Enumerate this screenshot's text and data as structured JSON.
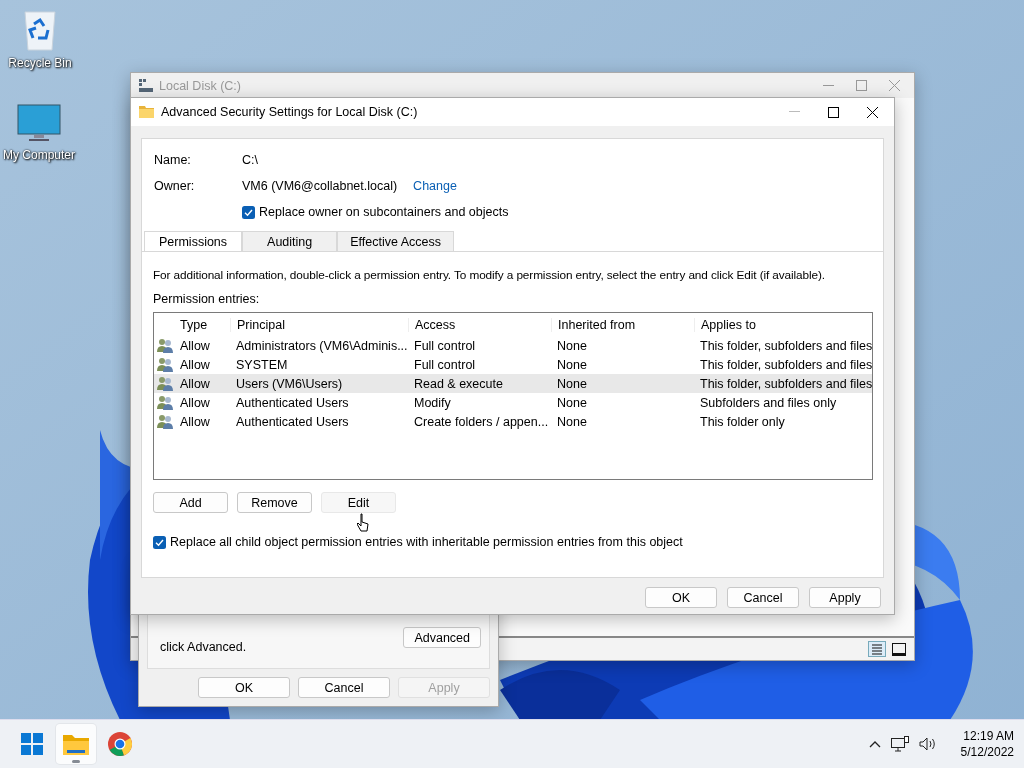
{
  "desktop_icons": [
    {
      "kind": "recycle",
      "label": "Recycle Bin"
    },
    {
      "kind": "computer",
      "label": "My Computer"
    }
  ],
  "back_window": {
    "title": "Local Disk (C:)"
  },
  "properties_dialog": {
    "text": "click Advanced.",
    "advanced_button": "Advanced",
    "buttons": [
      {
        "label": "OK",
        "disabled": false
      },
      {
        "label": "Cancel",
        "disabled": false
      },
      {
        "label": "Apply",
        "disabled": true
      }
    ]
  },
  "dialog": {
    "title": "Advanced Security Settings for Local Disk (C:)",
    "name_label": "Name:",
    "name_value": "C:\\",
    "owner_label": "Owner:",
    "owner_value": "VM6 (VM6@collabnet.local)",
    "change_link": "Change",
    "replace_owner": {
      "label": "Replace owner on subcontainers and objects",
      "checked": true
    },
    "tabs": [
      {
        "label": "Permissions",
        "selected": true
      },
      {
        "label": "Auditing",
        "selected": false
      },
      {
        "label": "Effective Access",
        "selected": false
      }
    ],
    "info_text": "For additional information, double-click a permission entry. To modify a permission entry, select the entry and click Edit (if available).",
    "entries_label": "Permission entries:",
    "columns": [
      "Type",
      "Principal",
      "Access",
      "Inherited from",
      "Applies to"
    ],
    "rows": [
      {
        "type": "Allow",
        "principal": "Administrators (VM6\\Adminis...",
        "access": "Full control",
        "inherited_from": "None",
        "applies_to": "This folder, subfolders and files",
        "selected": false
      },
      {
        "type": "Allow",
        "principal": "SYSTEM",
        "access": "Full control",
        "inherited_from": "None",
        "applies_to": "This folder, subfolders and files",
        "selected": false
      },
      {
        "type": "Allow",
        "principal": "Users (VM6\\Users)",
        "access": "Read & execute",
        "inherited_from": "None",
        "applies_to": "This folder, subfolders and files",
        "selected": true
      },
      {
        "type": "Allow",
        "principal": "Authenticated Users",
        "access": "Modify",
        "inherited_from": "None",
        "applies_to": "Subfolders and files only",
        "selected": false
      },
      {
        "type": "Allow",
        "principal": "Authenticated Users",
        "access": "Create folders / appen...",
        "inherited_from": "None",
        "applies_to": "This folder only",
        "selected": false
      }
    ],
    "action_buttons": [
      "Add",
      "Remove",
      "Edit"
    ],
    "replace_child": {
      "label": "Replace all child object permission entries with inheritable permission entries from this object",
      "checked": true
    },
    "buttons": [
      "OK",
      "Cancel",
      "Apply"
    ]
  },
  "taskbar": {
    "apps": [
      {
        "kind": "start",
        "running": false
      },
      {
        "kind": "explorer",
        "running": true
      },
      {
        "kind": "browser",
        "running": false
      }
    ],
    "time": "12:19 AM",
    "date": "5/12/2022"
  }
}
